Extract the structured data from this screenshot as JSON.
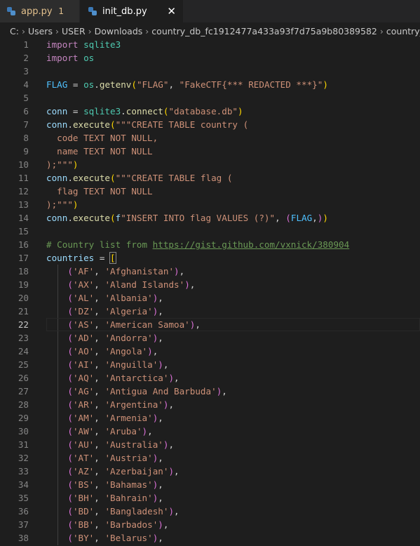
{
  "tabs": [
    {
      "name": "app.py",
      "badge": "1",
      "active": false
    },
    {
      "name": "init_db.py",
      "active": true
    }
  ],
  "breadcrumb": [
    "C:",
    "Users",
    "USER",
    "Downloads",
    "country_db_fc1912477a433a93f7d75a9b80389582",
    "country_db"
  ],
  "colors": {
    "keyword": "#c586c0",
    "module": "#4ec9b0",
    "variable": "#9cdcfe",
    "constant": "#4fc1ff",
    "function": "#dcdcaa",
    "string": "#ce9178",
    "comment": "#6a9955"
  },
  "editor": {
    "current_line": 22,
    "lines": [
      {
        "n": "1",
        "tokens": [
          [
            "kw",
            "import"
          ],
          [
            "d",
            " "
          ],
          [
            "mod",
            "sqlite3"
          ]
        ]
      },
      {
        "n": "2",
        "tokens": [
          [
            "kw",
            "import"
          ],
          [
            "d",
            " "
          ],
          [
            "mod",
            "os"
          ]
        ]
      },
      {
        "n": "3",
        "tokens": []
      },
      {
        "n": "4",
        "tokens": [
          [
            "cst",
            "FLAG"
          ],
          [
            "d",
            " = "
          ],
          [
            "mod",
            "os"
          ],
          [
            "d",
            "."
          ],
          [
            "fn",
            "getenv"
          ],
          [
            "b1",
            "("
          ],
          [
            "str",
            "\"FLAG\""
          ],
          [
            "d",
            ", "
          ],
          [
            "str",
            "\"FakeCTF{*** REDACTED ***}\""
          ],
          [
            "b1",
            ")"
          ]
        ]
      },
      {
        "n": "5",
        "tokens": []
      },
      {
        "n": "6",
        "tokens": [
          [
            "var",
            "conn"
          ],
          [
            "d",
            " = "
          ],
          [
            "mod",
            "sqlite3"
          ],
          [
            "d",
            "."
          ],
          [
            "fn",
            "connect"
          ],
          [
            "b1",
            "("
          ],
          [
            "str",
            "\"database.db\""
          ],
          [
            "b1",
            ")"
          ]
        ]
      },
      {
        "n": "7",
        "tokens": [
          [
            "var",
            "conn"
          ],
          [
            "d",
            "."
          ],
          [
            "fn",
            "execute"
          ],
          [
            "b1",
            "("
          ],
          [
            "str",
            "\"\"\"CREATE TABLE country ("
          ]
        ]
      },
      {
        "n": "8",
        "tokens": [
          [
            "str",
            "  code TEXT NOT NULL,"
          ]
        ]
      },
      {
        "n": "9",
        "tokens": [
          [
            "str",
            "  name TEXT NOT NULL"
          ]
        ]
      },
      {
        "n": "10",
        "tokens": [
          [
            "str",
            ");\"\"\""
          ],
          [
            "b1",
            ")"
          ]
        ]
      },
      {
        "n": "11",
        "tokens": [
          [
            "var",
            "conn"
          ],
          [
            "d",
            "."
          ],
          [
            "fn",
            "execute"
          ],
          [
            "b1",
            "("
          ],
          [
            "str",
            "\"\"\"CREATE TABLE flag ("
          ]
        ]
      },
      {
        "n": "12",
        "tokens": [
          [
            "str",
            "  flag TEXT NOT NULL"
          ]
        ]
      },
      {
        "n": "13",
        "tokens": [
          [
            "str",
            ");\"\"\""
          ],
          [
            "b1",
            ")"
          ]
        ]
      },
      {
        "n": "14",
        "tokens": [
          [
            "var",
            "conn"
          ],
          [
            "d",
            "."
          ],
          [
            "fn",
            "execute"
          ],
          [
            "b1",
            "("
          ],
          [
            "var",
            "f"
          ],
          [
            "str",
            "\"INSERT INTO flag VALUES (?)\""
          ],
          [
            "d",
            ", "
          ],
          [
            "b2",
            "("
          ],
          [
            "cst",
            "FLAG"
          ],
          [
            "d",
            ","
          ],
          [
            "b2",
            ")"
          ],
          [
            "b1",
            ")"
          ]
        ]
      },
      {
        "n": "15",
        "tokens": []
      },
      {
        "n": "16",
        "tokens": [
          [
            "cmt",
            "# Country list from "
          ],
          [
            "cmt link",
            "https://gist.github.com/vxnick/380904"
          ]
        ]
      },
      {
        "n": "17",
        "tokens": [
          [
            "var",
            "countries"
          ],
          [
            "d",
            " = "
          ],
          [
            "b1 bm",
            "["
          ]
        ]
      },
      {
        "n": "18",
        "tokens": [
          [
            "d",
            "    "
          ],
          [
            "b2",
            "("
          ],
          [
            "str",
            "'AF'"
          ],
          [
            "d",
            ", "
          ],
          [
            "str",
            "'Afghanistan'"
          ],
          [
            "b2",
            ")"
          ],
          [
            "d",
            ","
          ]
        ]
      },
      {
        "n": "19",
        "tokens": [
          [
            "d",
            "    "
          ],
          [
            "b2",
            "("
          ],
          [
            "str",
            "'AX'"
          ],
          [
            "d",
            ", "
          ],
          [
            "str",
            "'Aland Islands'"
          ],
          [
            "b2",
            ")"
          ],
          [
            "d",
            ","
          ]
        ]
      },
      {
        "n": "20",
        "tokens": [
          [
            "d",
            "    "
          ],
          [
            "b2",
            "("
          ],
          [
            "str",
            "'AL'"
          ],
          [
            "d",
            ", "
          ],
          [
            "str",
            "'Albania'"
          ],
          [
            "b2",
            ")"
          ],
          [
            "d",
            ","
          ]
        ]
      },
      {
        "n": "21",
        "tokens": [
          [
            "d",
            "    "
          ],
          [
            "b2",
            "("
          ],
          [
            "str",
            "'DZ'"
          ],
          [
            "d",
            ", "
          ],
          [
            "str",
            "'Algeria'"
          ],
          [
            "b2",
            ")"
          ],
          [
            "d",
            ","
          ]
        ]
      },
      {
        "n": "22",
        "tokens": [
          [
            "d",
            "    "
          ],
          [
            "b2",
            "("
          ],
          [
            "str",
            "'AS'"
          ],
          [
            "d",
            ", "
          ],
          [
            "str",
            "'American Samoa'"
          ],
          [
            "b2",
            ")"
          ],
          [
            "d",
            ","
          ]
        ]
      },
      {
        "n": "23",
        "tokens": [
          [
            "d",
            "    "
          ],
          [
            "b2",
            "("
          ],
          [
            "str",
            "'AD'"
          ],
          [
            "d",
            ", "
          ],
          [
            "str",
            "'Andorra'"
          ],
          [
            "b2",
            ")"
          ],
          [
            "d",
            ","
          ]
        ]
      },
      {
        "n": "24",
        "tokens": [
          [
            "d",
            "    "
          ],
          [
            "b2",
            "("
          ],
          [
            "str",
            "'AO'"
          ],
          [
            "d",
            ", "
          ],
          [
            "str",
            "'Angola'"
          ],
          [
            "b2",
            ")"
          ],
          [
            "d",
            ","
          ]
        ]
      },
      {
        "n": "25",
        "tokens": [
          [
            "d",
            "    "
          ],
          [
            "b2",
            "("
          ],
          [
            "str",
            "'AI'"
          ],
          [
            "d",
            ", "
          ],
          [
            "str",
            "'Anguilla'"
          ],
          [
            "b2",
            ")"
          ],
          [
            "d",
            ","
          ]
        ]
      },
      {
        "n": "26",
        "tokens": [
          [
            "d",
            "    "
          ],
          [
            "b2",
            "("
          ],
          [
            "str",
            "'AQ'"
          ],
          [
            "d",
            ", "
          ],
          [
            "str",
            "'Antarctica'"
          ],
          [
            "b2",
            ")"
          ],
          [
            "d",
            ","
          ]
        ]
      },
      {
        "n": "27",
        "tokens": [
          [
            "d",
            "    "
          ],
          [
            "b2",
            "("
          ],
          [
            "str",
            "'AG'"
          ],
          [
            "d",
            ", "
          ],
          [
            "str",
            "'Antigua And Barbuda'"
          ],
          [
            "b2",
            ")"
          ],
          [
            "d",
            ","
          ]
        ]
      },
      {
        "n": "28",
        "tokens": [
          [
            "d",
            "    "
          ],
          [
            "b2",
            "("
          ],
          [
            "str",
            "'AR'"
          ],
          [
            "d",
            ", "
          ],
          [
            "str",
            "'Argentina'"
          ],
          [
            "b2",
            ")"
          ],
          [
            "d",
            ","
          ]
        ]
      },
      {
        "n": "29",
        "tokens": [
          [
            "d",
            "    "
          ],
          [
            "b2",
            "("
          ],
          [
            "str",
            "'AM'"
          ],
          [
            "d",
            ", "
          ],
          [
            "str",
            "'Armenia'"
          ],
          [
            "b2",
            ")"
          ],
          [
            "d",
            ","
          ]
        ]
      },
      {
        "n": "30",
        "tokens": [
          [
            "d",
            "    "
          ],
          [
            "b2",
            "("
          ],
          [
            "str",
            "'AW'"
          ],
          [
            "d",
            ", "
          ],
          [
            "str",
            "'Aruba'"
          ],
          [
            "b2",
            ")"
          ],
          [
            "d",
            ","
          ]
        ]
      },
      {
        "n": "31",
        "tokens": [
          [
            "d",
            "    "
          ],
          [
            "b2",
            "("
          ],
          [
            "str",
            "'AU'"
          ],
          [
            "d",
            ", "
          ],
          [
            "str",
            "'Australia'"
          ],
          [
            "b2",
            ")"
          ],
          [
            "d",
            ","
          ]
        ]
      },
      {
        "n": "32",
        "tokens": [
          [
            "d",
            "    "
          ],
          [
            "b2",
            "("
          ],
          [
            "str",
            "'AT'"
          ],
          [
            "d",
            ", "
          ],
          [
            "str",
            "'Austria'"
          ],
          [
            "b2",
            ")"
          ],
          [
            "d",
            ","
          ]
        ]
      },
      {
        "n": "33",
        "tokens": [
          [
            "d",
            "    "
          ],
          [
            "b2",
            "("
          ],
          [
            "str",
            "'AZ'"
          ],
          [
            "d",
            ", "
          ],
          [
            "str",
            "'Azerbaijan'"
          ],
          [
            "b2",
            ")"
          ],
          [
            "d",
            ","
          ]
        ]
      },
      {
        "n": "34",
        "tokens": [
          [
            "d",
            "    "
          ],
          [
            "b2",
            "("
          ],
          [
            "str",
            "'BS'"
          ],
          [
            "d",
            ", "
          ],
          [
            "str",
            "'Bahamas'"
          ],
          [
            "b2",
            ")"
          ],
          [
            "d",
            ","
          ]
        ]
      },
      {
        "n": "35",
        "tokens": [
          [
            "d",
            "    "
          ],
          [
            "b2",
            "("
          ],
          [
            "str",
            "'BH'"
          ],
          [
            "d",
            ", "
          ],
          [
            "str",
            "'Bahrain'"
          ],
          [
            "b2",
            ")"
          ],
          [
            "d",
            ","
          ]
        ]
      },
      {
        "n": "36",
        "tokens": [
          [
            "d",
            "    "
          ],
          [
            "b2",
            "("
          ],
          [
            "str",
            "'BD'"
          ],
          [
            "d",
            ", "
          ],
          [
            "str",
            "'Bangladesh'"
          ],
          [
            "b2",
            ")"
          ],
          [
            "d",
            ","
          ]
        ]
      },
      {
        "n": "37",
        "tokens": [
          [
            "d",
            "    "
          ],
          [
            "b2",
            "("
          ],
          [
            "str",
            "'BB'"
          ],
          [
            "d",
            ", "
          ],
          [
            "str",
            "'Barbados'"
          ],
          [
            "b2",
            ")"
          ],
          [
            "d",
            ","
          ]
        ]
      },
      {
        "n": "38",
        "tokens": [
          [
            "d",
            "    "
          ],
          [
            "b2",
            "("
          ],
          [
            "str",
            "'BY'"
          ],
          [
            "d",
            ", "
          ],
          [
            "str",
            "'Belarus'"
          ],
          [
            "b2",
            ")"
          ],
          [
            "d",
            ","
          ]
        ]
      }
    ]
  }
}
